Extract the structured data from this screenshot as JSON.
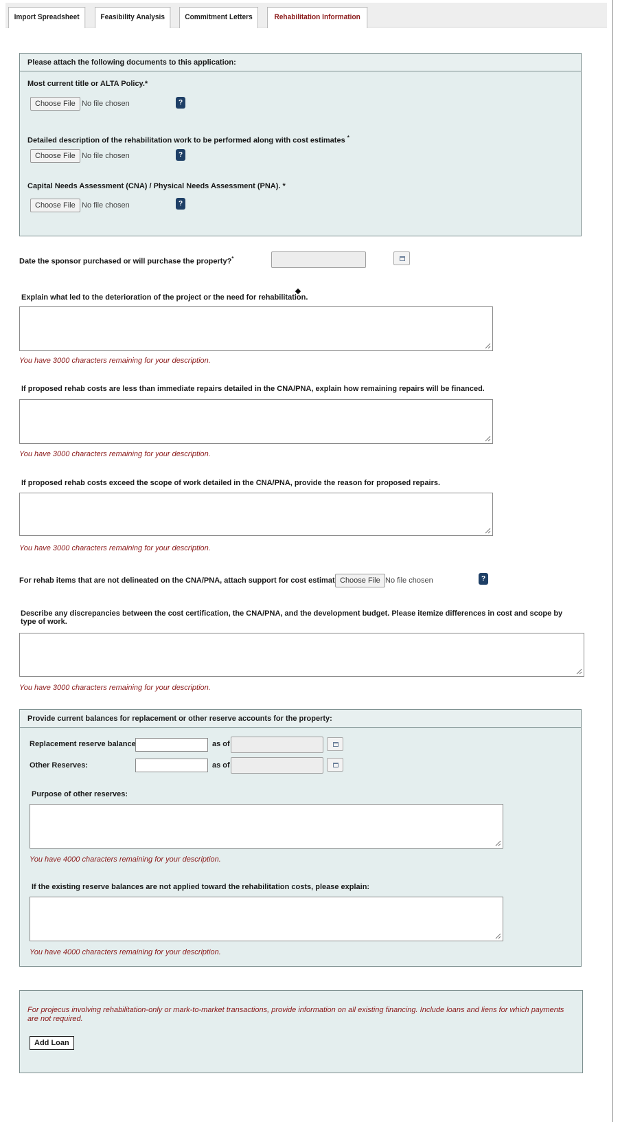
{
  "tabs": [
    {
      "label": "Import Spreadsheet"
    },
    {
      "label": "Feasibility Analysis"
    },
    {
      "label": "Commitment Letters"
    },
    {
      "label": "Rehabilitation Information"
    }
  ],
  "file_common": {
    "button": "Choose File",
    "status": "No file chosen",
    "help": "?"
  },
  "attachments": {
    "header": "Please attach the following documents to this application:",
    "items": [
      {
        "label": "Most current title or ALTA Policy.",
        "req": "*"
      },
      {
        "label": "Detailed description of the rehabilitation work to be performed along with cost estimates ",
        "req": "*"
      },
      {
        "label": "Capital Needs Assessment (CNA) / Physical Needs Assessment (PNA). *",
        "req": ""
      }
    ]
  },
  "purchase_date": {
    "label": "Date the sponsor purchased or will purchase the property?",
    "req": "*",
    "value": ""
  },
  "q_deterioration": {
    "label": "Explain what led to the deterioration of the project or the need for rehabilitation.",
    "value": "",
    "remaining": "You have 3000 characters remaining for your description."
  },
  "q_less": {
    "label": "If proposed rehab costs are less than immediate repairs detailed in the CNA/PNA, explain how remaining repairs will be financed.",
    "value": "",
    "remaining": "You have 3000 characters remaining for your description."
  },
  "q_exceed": {
    "label": "If proposed rehab costs exceed the scope of work detailed in the CNA/PNA, provide the reason for proposed repairs.",
    "value": "",
    "remaining": "You have 3000 characters remaining for your description."
  },
  "support_attach": {
    "label": "For rehab items that are not delineated on the CNA/PNA, attach support for cost estimates."
  },
  "q_discrepancies": {
    "label": "Describe any discrepancies between the cost certification, the CNA/PNA, and the development budget. Please itemize differences in cost and scope by type of work.",
    "value": "",
    "remaining": "You have 3000 characters remaining for your description."
  },
  "reserves": {
    "header": "Provide current balances for replacement or other reserve accounts for the property:",
    "replacement_label": "Replacement reserve balance:",
    "replacement_value": "",
    "replacement_date": "",
    "other_label": "Other Reserves:",
    "other_value": "",
    "other_date": "",
    "as_of": "as of",
    "purpose_label": "Purpose of other reserves:",
    "purpose_value": "",
    "purpose_remaining": "You have 4000 characters remaining for your description.",
    "explain_label": "If the existing reserve balances are not applied toward the rehabilitation costs, please explain:",
    "explain_value": "",
    "explain_remaining": "You have 4000 characters remaining for your description."
  },
  "financing": {
    "note": "For projecus involving rehabilitation-only or mark-to-market transactions, provide information on all existing financing. Include loans and liens for which payments are not required.",
    "add_loan": "Add Loan"
  },
  "colors": {
    "accent_red": "#8b1a1a",
    "panel_bg": "#e4eeee",
    "help_blue": "#1e3f66"
  }
}
